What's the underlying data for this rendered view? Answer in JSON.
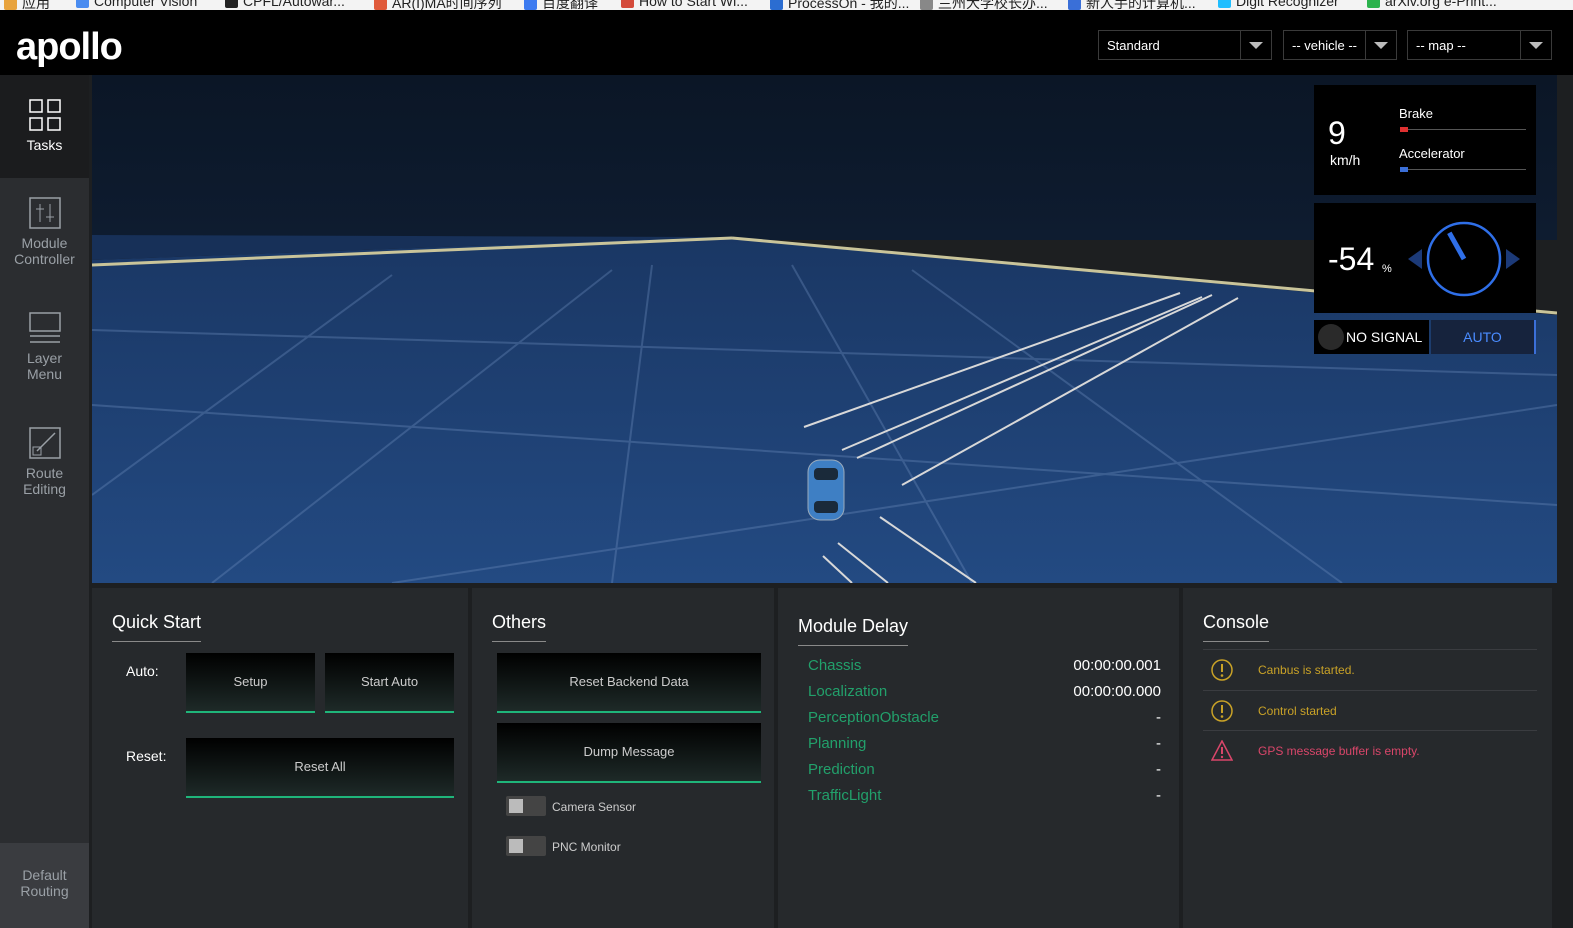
{
  "bookmarks": [
    {
      "label": "应用",
      "icon": "apps-grid-icon",
      "color": "#e8a33d"
    },
    {
      "label": "Computer Vision",
      "icon": "site-icon",
      "color": "#4a8cf0"
    },
    {
      "label": "CPFL/Autowar...",
      "icon": "github-icon",
      "color": "#222222"
    },
    {
      "label": "AR(I)MA时间序列",
      "icon": "site-icon",
      "color": "#e05a3a"
    },
    {
      "label": "百度翻译",
      "icon": "translate-icon",
      "color": "#3d7bf0"
    },
    {
      "label": "How to Start Wi...",
      "icon": "page-icon",
      "color": "#d44a3a"
    },
    {
      "label": "ProcessOn - 我的...",
      "icon": "processon-icon",
      "color": "#2b6dd1"
    },
    {
      "label": "兰州大学校长办...",
      "icon": "page-icon",
      "color": "#888888"
    },
    {
      "label": "新人手的计算机...",
      "icon": "site-icon",
      "color": "#3a6fd8"
    },
    {
      "label": "Digit Recognizer",
      "icon": "kaggle-icon",
      "color": "#20beff"
    },
    {
      "label": "arXiv.org e-Print...",
      "icon": "site-icon",
      "color": "#2bb24c"
    }
  ],
  "header": {
    "logo": "apollo",
    "mode_select": "Standard",
    "vehicle_select": "-- vehicle --",
    "map_select": "-- map --"
  },
  "sidebar": {
    "items": [
      {
        "label_line1": "Tasks",
        "label_line2": "",
        "icon": "grid-icon",
        "active": true
      },
      {
        "label_line1": "Module",
        "label_line2": "Controller",
        "icon": "sliders-icon",
        "active": false
      },
      {
        "label_line1": "Layer",
        "label_line2": "Menu",
        "icon": "layers-icon",
        "active": false
      },
      {
        "label_line1": "Route",
        "label_line2": "Editing",
        "icon": "route-icon",
        "active": false
      }
    ],
    "bottom_line1": "Default",
    "bottom_line2": "Routing"
  },
  "dashboard": {
    "speed": "9",
    "speed_unit": "km/h",
    "brake_label": "Brake",
    "brake_level": 0.05,
    "accelerator_label": "Accelerator",
    "accelerator_level": 0.05,
    "steering": "-54",
    "steering_unit": "%",
    "signal": "NO SIGNAL",
    "mode": "AUTO",
    "colors": {
      "brake": "#e03131",
      "accelerator": "#3b6fd8",
      "wheel": "#2f6fe8"
    }
  },
  "quick_start": {
    "title": "Quick Start",
    "auto_label": "Auto:",
    "setup_button": "Setup",
    "start_auto_button": "Start Auto",
    "reset_label": "Reset:",
    "reset_all_button": "Reset All"
  },
  "others": {
    "title": "Others",
    "reset_backend_button": "Reset Backend Data",
    "dump_message_button": "Dump Message",
    "toggles": [
      {
        "label": "Camera Sensor",
        "on": false
      },
      {
        "label": "PNC Monitor",
        "on": false
      }
    ]
  },
  "module_delay": {
    "title": "Module Delay",
    "rows": [
      {
        "name": "Chassis",
        "value": "00:00:00.001"
      },
      {
        "name": "Localization",
        "value": "00:00:00.000"
      },
      {
        "name": "PerceptionObstacle",
        "value": "-"
      },
      {
        "name": "Planning",
        "value": "-"
      },
      {
        "name": "Prediction",
        "value": "-"
      },
      {
        "name": "TrafficLight",
        "value": "-"
      }
    ]
  },
  "console": {
    "title": "Console",
    "messages": [
      {
        "text": "Canbus is started.",
        "level": "warning",
        "icon": "warning-circle-icon",
        "color": "#c9a227"
      },
      {
        "text": "Control started",
        "level": "warning",
        "icon": "warning-circle-icon",
        "color": "#c9a227"
      },
      {
        "text": "GPS message buffer is empty.",
        "level": "error",
        "icon": "warning-triangle-icon",
        "color": "#d9466a"
      }
    ]
  }
}
